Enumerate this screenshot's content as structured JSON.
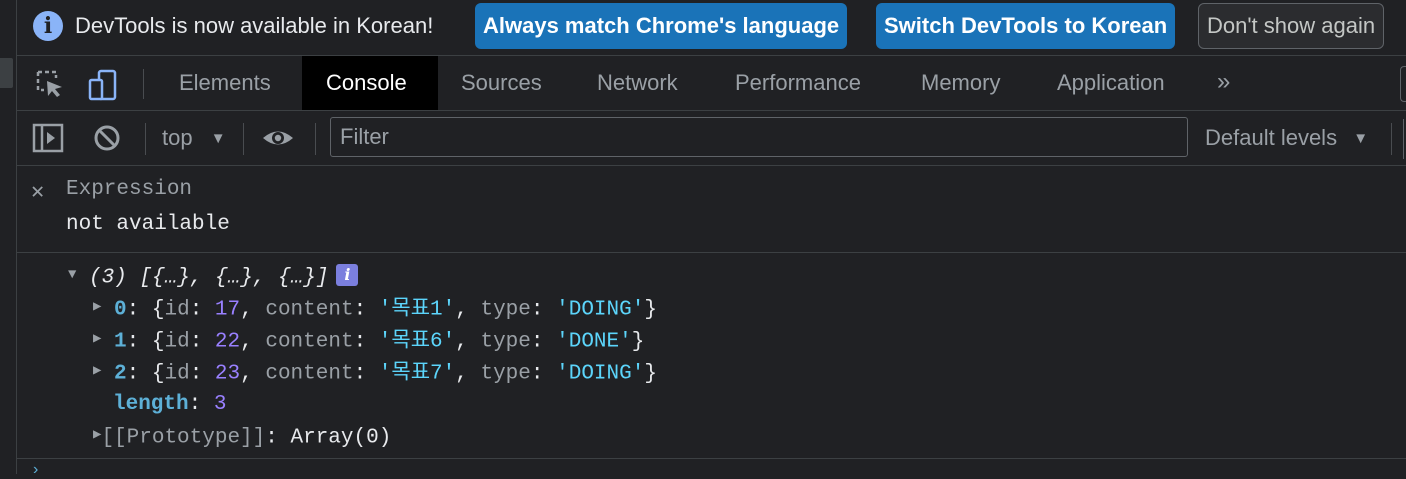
{
  "infobar": {
    "message": "DevTools is now available in Korean!",
    "btn_match": "Always match Chrome's language",
    "btn_switch": "Switch DevTools to Korean",
    "btn_dismiss": "Don't show again"
  },
  "tabs": {
    "elements": "Elements",
    "console": "Console",
    "sources": "Sources",
    "network": "Network",
    "performance": "Performance",
    "memory": "Memory",
    "application": "Application",
    "more": "»"
  },
  "toolbar": {
    "context": "top",
    "filter_placeholder": "Filter",
    "levels": "Default levels"
  },
  "live_expression": {
    "label": "Expression",
    "value": "not available"
  },
  "output": {
    "summary_count": "(3)",
    "summary_items": "[{…}, {…}, {…}]",
    "items": [
      {
        "index": "0",
        "id": "17",
        "content": "목표1",
        "type": "DOING"
      },
      {
        "index": "1",
        "id": "22",
        "content": "목표6",
        "type": "DONE"
      },
      {
        "index": "2",
        "id": "23",
        "content": "목표7",
        "type": "DOING"
      }
    ],
    "length_key": "length",
    "length_value": "3",
    "prototype_key": "[[Prototype]]",
    "prototype_value": "Array(0)"
  },
  "colors": {
    "accent_blue": "#1a73b8",
    "index_blue": "#5db0d7",
    "number_purple": "#9980ff",
    "string_cyan": "#5cd5fb"
  }
}
